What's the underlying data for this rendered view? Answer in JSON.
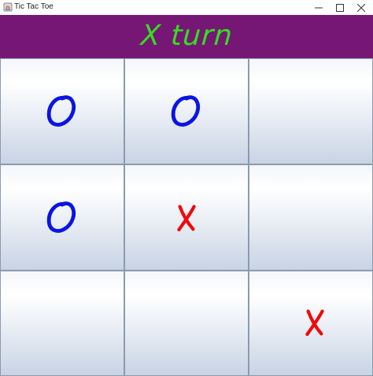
{
  "window": {
    "title": "Tic Tac Toe",
    "icons": {
      "app": "java-app-icon",
      "minimize": "minimize-icon",
      "maximize": "maximize-icon",
      "close": "close-icon"
    }
  },
  "status": {
    "text": "X turn",
    "background_color": "#761775",
    "text_color": "#33e01d"
  },
  "board": {
    "cells": [
      {
        "row": 1,
        "col": 1,
        "mark": "O"
      },
      {
        "row": 1,
        "col": 2,
        "mark": "O"
      },
      {
        "row": 1,
        "col": 3,
        "mark": ""
      },
      {
        "row": 2,
        "col": 1,
        "mark": "O"
      },
      {
        "row": 2,
        "col": 2,
        "mark": "X"
      },
      {
        "row": 2,
        "col": 3,
        "mark": ""
      },
      {
        "row": 3,
        "col": 1,
        "mark": ""
      },
      {
        "row": 3,
        "col": 2,
        "mark": ""
      },
      {
        "row": 3,
        "col": 3,
        "mark": "X"
      }
    ],
    "colors": {
      "O": "#0a14e6",
      "X": "#f00a0a"
    }
  }
}
